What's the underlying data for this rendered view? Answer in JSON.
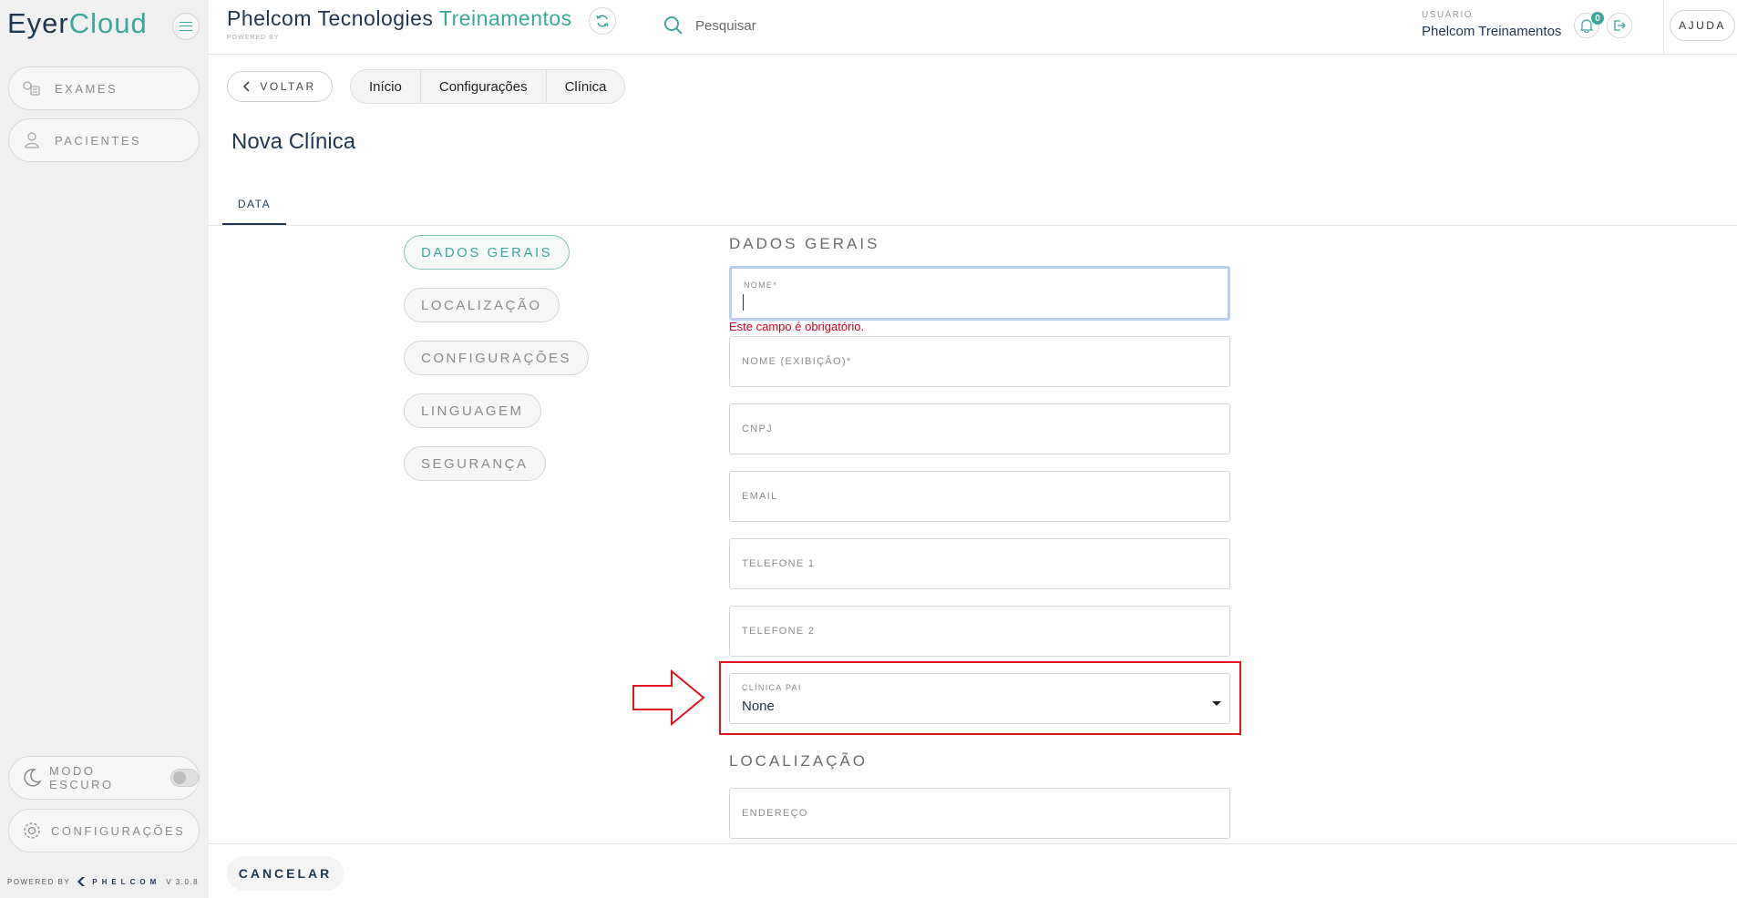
{
  "app": {
    "logo_part1": "Eyer",
    "logo_part2": "Cloud"
  },
  "sidebar": {
    "items": [
      {
        "label": "EXAMES",
        "icon": "exams-icon"
      },
      {
        "label": "PACIENTES",
        "icon": "user-icon"
      }
    ],
    "dark_mode_label": "MODO ESCURO",
    "settings_label": "CONFIGURAÇÕES",
    "powered_by": "POWERED BY",
    "brand": "PHELCOM",
    "version": "V 3.0.8"
  },
  "header": {
    "title_main": "Phelcom Tecnologies ",
    "title_accent": "Treinamentos",
    "subtitle": "POWERED BY",
    "search_placeholder": "Pesquisar",
    "user_label": "USUÁRIO",
    "user_name": "Phelcom Treinamentos",
    "notifications": "0",
    "help_label": "AJUDA"
  },
  "nav": {
    "back_label": "VOLTAR",
    "breadcrumbs": [
      "Início",
      "Configurações",
      "Clínica"
    ]
  },
  "page": {
    "title": "Nova Clínica",
    "tab": "DATA"
  },
  "sections": [
    "DADOS GERAIS",
    "LOCALIZAÇÃO",
    "CONFIGURAÇÕES",
    "LINGUAGEM",
    "SEGURANÇA"
  ],
  "form": {
    "general_heading": "DADOS GERAIS",
    "name_label": "NOME*",
    "name_error": "Este campo é obrigatório.",
    "display_name_label": "NOME (EXIBIÇÃO)*",
    "cnpj_label": "CNPJ",
    "email_label": "EMAIL",
    "phone1_label": "TELEFONE 1",
    "phone2_label": "TELEFONE 2",
    "parent_label": "CLÍNICA PAI",
    "parent_value": "None",
    "location_heading": "LOCALIZAÇÃO",
    "address_label": "ENDEREÇO"
  },
  "footer": {
    "cancel_label": "CANCELAR"
  },
  "colors": {
    "accent": "#3aa89a",
    "navy": "#1f3650",
    "error": "#d0021b",
    "annotation": "#e0151e"
  }
}
